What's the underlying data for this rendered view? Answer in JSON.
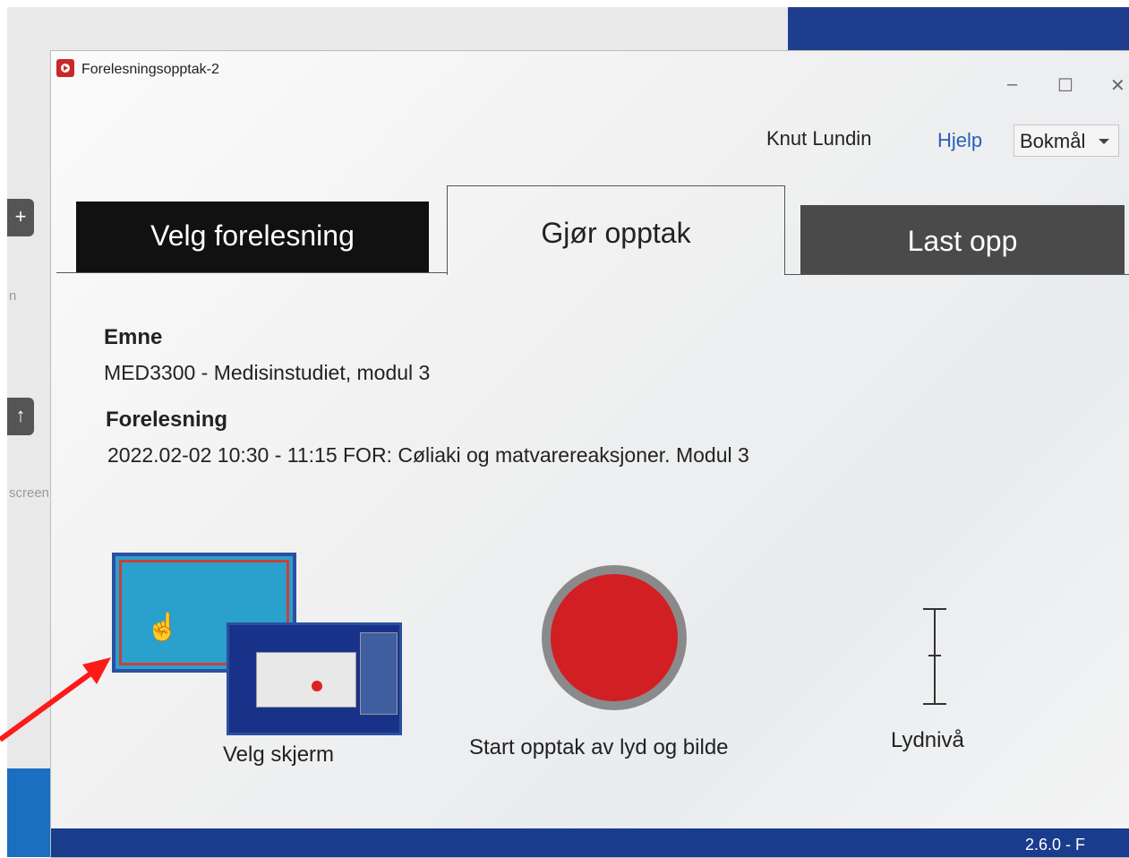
{
  "desktop": {
    "side_label_1": "n",
    "side_label_2": "screen"
  },
  "window": {
    "title": "Forelesningsopptak-2",
    "controls": {
      "minimize": "–",
      "maximize": "☐",
      "close": "✕"
    }
  },
  "header": {
    "user_name": "Knut Lundin",
    "help_label": "Hjelp",
    "language_selected": "Bokmål"
  },
  "tabs": [
    {
      "label": "Velg forelesning"
    },
    {
      "label": "Gjør opptak"
    },
    {
      "label": "Last opp"
    }
  ],
  "details": {
    "course_label": "Emne",
    "course_value": "MED3300 - Medisinstudiet, modul 3",
    "lecture_label": "Forelesning",
    "lecture_value": "2022.02-02 10:30 - 11:15 FOR: Cøliaki og matvarereaksjoner. Modul 3"
  },
  "actions": {
    "choose_screen_label": "Velg skjerm",
    "start_recording_label": "Start opptak av lyd og bilde",
    "sound_level_label": "Lydnivå"
  },
  "footer": {
    "version": "2.6.0 - F"
  },
  "colors": {
    "record_red": "#d11f24",
    "tab_active_bg": "#111111",
    "tab_upload_bg": "#4a4a4a",
    "link_blue": "#2b5fb8",
    "annotation_arrow": "#ff1a1a"
  }
}
